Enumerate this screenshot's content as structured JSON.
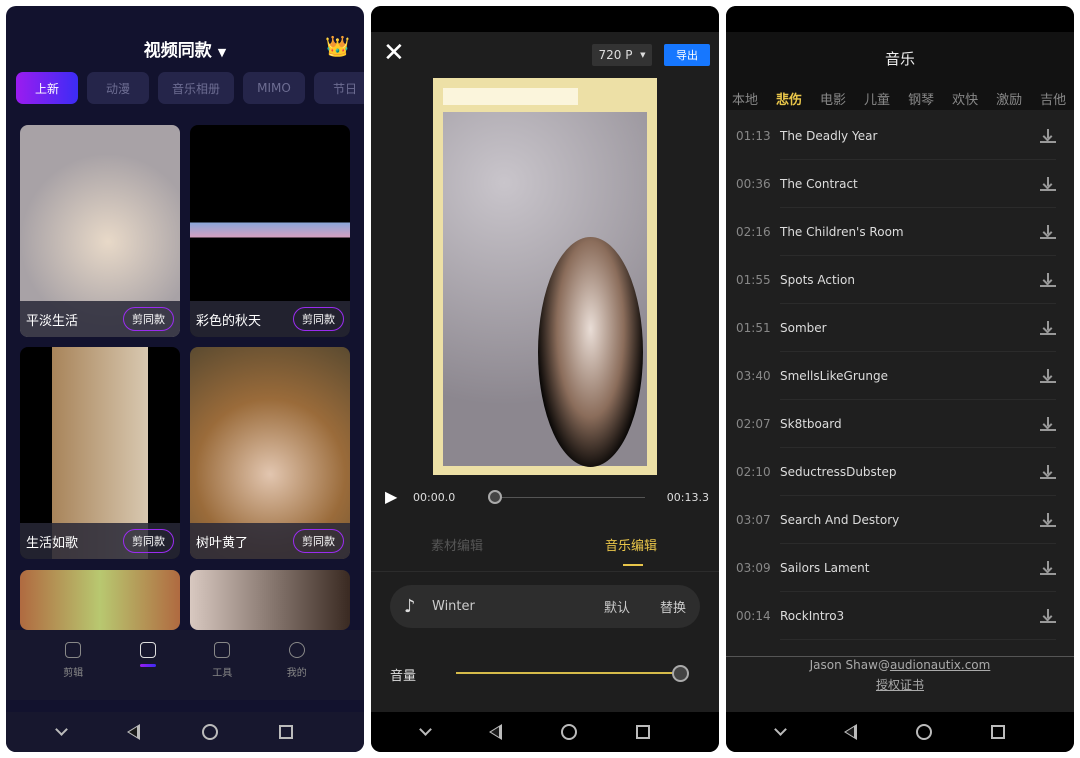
{
  "panel1": {
    "title": "视频同款",
    "chips": [
      "上新",
      "动漫",
      "音乐相册",
      "MIMO",
      "节日"
    ],
    "cards": [
      {
        "title": "平淡生活",
        "button": "剪同款"
      },
      {
        "title": "彩色的秋天",
        "button": "剪同款"
      },
      {
        "title": "生活如歌",
        "button": "剪同款"
      },
      {
        "title": "树叶黄了",
        "button": "剪同款"
      }
    ],
    "nav": [
      "剪辑",
      "",
      "工具",
      "我的"
    ],
    "accent": "#9b1cf0"
  },
  "panel2": {
    "resolution": "720 P",
    "export": "导出",
    "time_current": "00:00.0",
    "time_total": "00:13.3",
    "progress": 0,
    "tabs": [
      "素材编辑",
      "音乐编辑"
    ],
    "active_tab": 1,
    "track": "Winter",
    "default_label": "默认",
    "replace_label": "替换",
    "volume_label": "音量",
    "volume": 1.0,
    "accent": "#e8c54a"
  },
  "panel3": {
    "title": "音乐",
    "tabs": [
      "本地",
      "悲伤",
      "电影",
      "儿童",
      "钢琴",
      "欢快",
      "激励",
      "吉他"
    ],
    "active_tab": 1,
    "tracks": [
      {
        "duration": "01:13",
        "name": "The Deadly Year"
      },
      {
        "duration": "00:36",
        "name": "The Contract"
      },
      {
        "duration": "02:16",
        "name": "The Children's Room"
      },
      {
        "duration": "01:55",
        "name": "Spots Action"
      },
      {
        "duration": "01:51",
        "name": "Somber"
      },
      {
        "duration": "03:40",
        "name": "SmellsLikeGrunge"
      },
      {
        "duration": "02:07",
        "name": "Sk8tboard"
      },
      {
        "duration": "02:10",
        "name": "SeductressDubstep"
      },
      {
        "duration": "03:07",
        "name": "Search And Destory"
      },
      {
        "duration": "03:09",
        "name": "Sailors Lament"
      },
      {
        "duration": "00:14",
        "name": "RockIntro3"
      }
    ],
    "credit_name": "Jason Shaw@",
    "credit_link": "audionautix.com",
    "license": "授权证书"
  }
}
